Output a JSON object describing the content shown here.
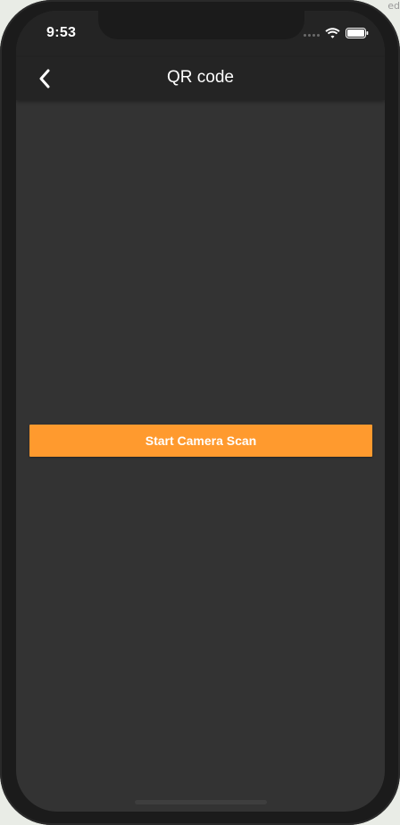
{
  "edge_text": "ed",
  "status_bar": {
    "time": "9:53",
    "icons": [
      "signal-dots-icon",
      "wifi-icon",
      "battery-icon"
    ]
  },
  "nav": {
    "back_icon": "chevron-left-icon",
    "title": "QR code"
  },
  "main": {
    "scan_button_label": "Start Camera Scan"
  },
  "colors": {
    "accent": "#ff9a2e",
    "background": "#333333",
    "bar": "#242424",
    "text": "#ffffff"
  }
}
